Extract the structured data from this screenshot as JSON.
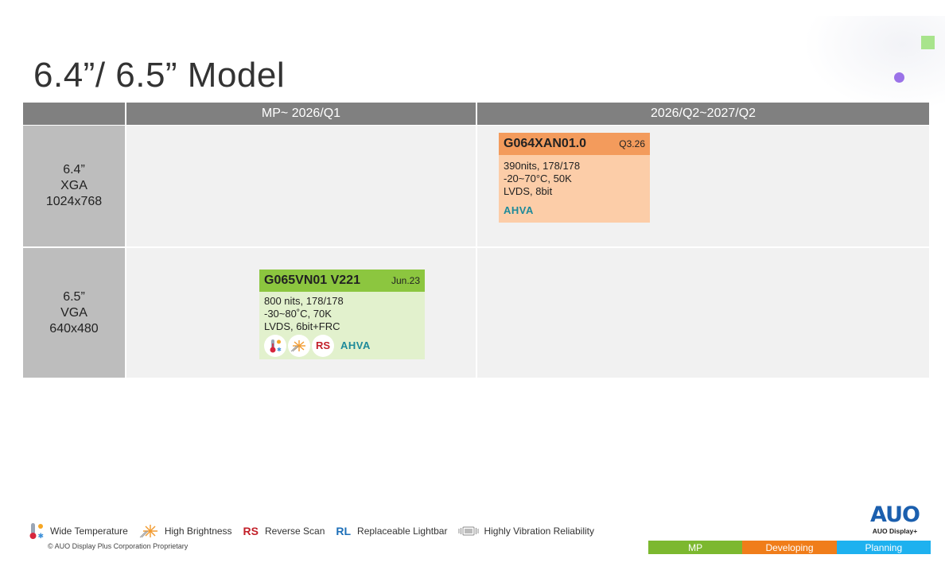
{
  "slide": {
    "title": "6.4”/ 6.5” Model"
  },
  "columns": [
    {
      "label": "MP~ 2026/Q1"
    },
    {
      "label": "2026/Q2~2027/Q2"
    }
  ],
  "rows": [
    {
      "size": "6.4”",
      "res_name": "XGA",
      "resolution": "1024x768"
    },
    {
      "size": "6.5”",
      "res_name": "VGA",
      "resolution": "640x480"
    }
  ],
  "cards": [
    {
      "model": "G064XAN01.0",
      "date": "Q3.26",
      "specs": [
        "390nits, 178/178",
        "-20~70°C, 50K",
        "LVDS, 8bit"
      ],
      "tech": "AHVA",
      "head_color": "#f39b5c",
      "body_color": "#fccda8"
    },
    {
      "model": "G065VN01 V221",
      "date": "Jun.23",
      "specs": [
        "800 nits, 178/178",
        "-30~80˚C, 70K",
        "LVDS, 6bit+FRC"
      ],
      "badge_rs": "RS",
      "tech": "AHVA",
      "icons": [
        "wide-temperature-icon",
        "high-brightness-icon"
      ],
      "head_color": "#8cc63f",
      "body_color": "#e2f1cd"
    }
  ],
  "legend": [
    {
      "icon": "wide-temperature-icon",
      "label": "Wide Temperature"
    },
    {
      "icon": "high-brightness-icon",
      "label": "High Brightness"
    },
    {
      "badge": "RS",
      "label": "Reverse Scan"
    },
    {
      "badge": "RL",
      "label": "Replaceable Lightbar"
    },
    {
      "icon": "vibration-icon",
      "label": "Highly Vibration Reliability"
    }
  ],
  "footer": {
    "copyright": "© AUO Display Plus Corporation Proprietary",
    "logo": "AUO",
    "logo_sub": "AUO Display+"
  },
  "status": [
    {
      "label": "MP",
      "color": "#7cb82f"
    },
    {
      "label": "Developing",
      "color": "#f07d1a"
    },
    {
      "label": "Planning",
      "color": "#1eb1ef"
    }
  ]
}
